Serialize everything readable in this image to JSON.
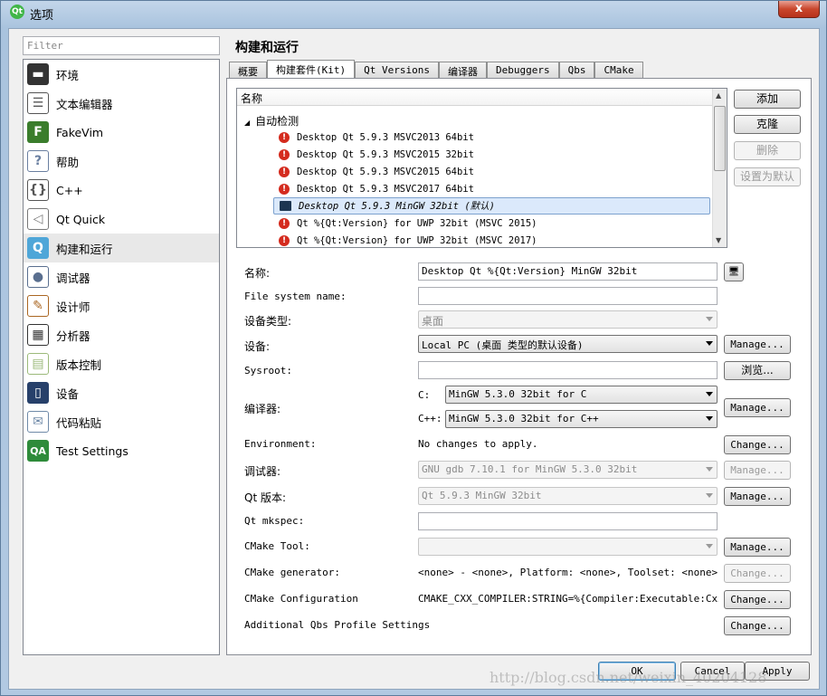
{
  "window": {
    "title": "选项",
    "app_icon": "Qt",
    "close_symbol": "x"
  },
  "filter": {
    "placeholder": "Filter"
  },
  "categories": [
    {
      "label": "环境",
      "icon": "monitor-icon",
      "color": "#333333"
    },
    {
      "label": "文本编辑器",
      "icon": "text-editor-icon",
      "color": "#555555"
    },
    {
      "label": "FakeVim",
      "icon": "fakevim-icon",
      "color": "#3a7d2c"
    },
    {
      "label": "帮助",
      "icon": "help-icon",
      "color": "#6a7fa0"
    },
    {
      "label": "C++",
      "icon": "braces-icon",
      "color": "#555555"
    },
    {
      "label": "Qt Quick",
      "icon": "plane-icon",
      "color": "#777777"
    },
    {
      "label": "构建和运行",
      "icon": "build-run-icon",
      "color": "#4fa6d8",
      "selected": true
    },
    {
      "label": "调试器",
      "icon": "debugger-icon",
      "color": "#5a6f8f"
    },
    {
      "label": "设计师",
      "icon": "designer-icon",
      "color": "#aa6622"
    },
    {
      "label": "分析器",
      "icon": "analyzer-icon",
      "color": "#333333"
    },
    {
      "label": "版本控制",
      "icon": "version-control-icon",
      "color": "#9cba7a"
    },
    {
      "label": "设备",
      "icon": "device-icon",
      "color": "#27406a"
    },
    {
      "label": "代码粘贴",
      "icon": "code-paste-icon",
      "color": "#6f8aa8"
    },
    {
      "label": "Test Settings",
      "icon": "qa-icon",
      "color": "#2e8b3a"
    }
  ],
  "page": {
    "title": "构建和运行"
  },
  "tabs": [
    "概要",
    "构建套件(Kit)",
    "Qt Versions",
    "编译器",
    "Debuggers",
    "Qbs",
    "CMake"
  ],
  "kits": {
    "header": "名称",
    "group": "自动检测",
    "items": [
      {
        "label": "Desktop Qt 5.9.3 MSVC2013 64bit",
        "status": "error"
      },
      {
        "label": "Desktop Qt 5.9.3 MSVC2015 32bit",
        "status": "error"
      },
      {
        "label": "Desktop Qt 5.9.3 MSVC2015 64bit",
        "status": "error"
      },
      {
        "label": "Desktop Qt 5.9.3 MSVC2017 64bit",
        "status": "error"
      },
      {
        "label": "Desktop Qt 5.9.3 MinGW 32bit (默认)",
        "status": "ok",
        "selected": true
      },
      {
        "label": "Qt %{Qt:Version} for UWP 32bit (MSVC 2015)",
        "status": "error"
      },
      {
        "label": "Qt %{Qt:Version} for UWP 32bit (MSVC 2017)",
        "status": "error"
      }
    ]
  },
  "kit_buttons": {
    "add": "添加",
    "clone": "克隆",
    "remove": "删除",
    "make_default": "设置为默认"
  },
  "form": {
    "name_label": "名称:",
    "name_value": "Desktop Qt %{Qt:Version} MinGW 32bit",
    "fs_label": "File system name:",
    "fs_value": "",
    "device_type_label": "设备类型:",
    "device_type_value": "桌面",
    "device_label": "设备:",
    "device_value": "Local PC (桌面 类型的默认设备)",
    "sysroot_label": "Sysroot:",
    "sysroot_value": "",
    "compiler_label": "编译器:",
    "c_label": "C:",
    "c_value": "MinGW 5.3.0 32bit for C",
    "cpp_label": "C++:",
    "cpp_value": "MinGW 5.3.0 32bit for C++",
    "env_label": "Environment:",
    "env_value": "No changes to apply.",
    "debugger_label": "调试器:",
    "debugger_value": "GNU gdb 7.10.1 for MinGW 5.3.0 32bit",
    "qtver_label": "Qt 版本:",
    "qtver_value": "Qt 5.9.3 MinGW 32bit",
    "mkspec_label": "Qt mkspec:",
    "mkspec_value": "",
    "cmake_tool_label": "CMake Tool:",
    "cmake_tool_value": "",
    "cmake_gen_label": "CMake generator:",
    "cmake_gen_value": "<none> - <none>, Platform: <none>, Toolset: <none>",
    "cmake_conf_label": "CMake Configuration",
    "cmake_conf_value": "CMAKE_CXX_COMPILER:STRING=%{Compiler:Executable:Cxx};…",
    "qbs_label": "Additional Qbs Profile Settings",
    "manage": "Manage...",
    "browse": "浏览...",
    "change": "Change..."
  },
  "footer": {
    "ok": "OK",
    "cancel": "Cancel",
    "apply": "Apply"
  },
  "watermark": "http://blog.csdn.net/weixin_40204128"
}
